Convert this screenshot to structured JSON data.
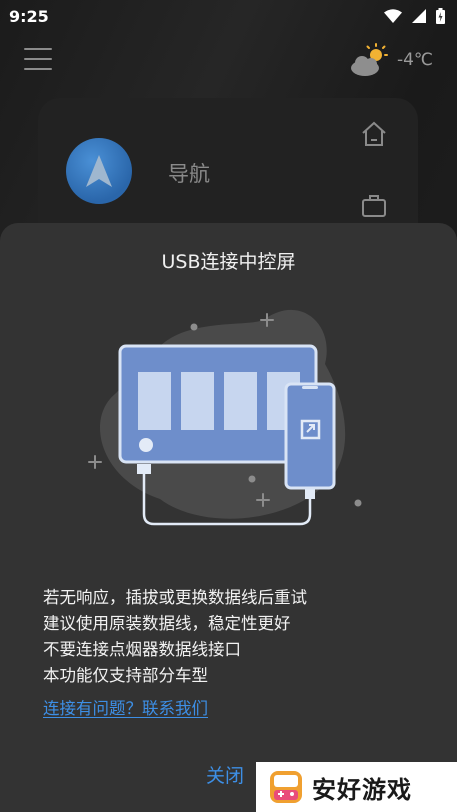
{
  "status_bar": {
    "time": "9:25",
    "icons": [
      "wifi-icon",
      "signal-icon",
      "battery-icon"
    ]
  },
  "header": {
    "menu_icon": "hamburger-menu-icon",
    "weather_icon": "partly-cloudy-icon",
    "temperature": "-4℃"
  },
  "home_card": {
    "nav_label": "导航",
    "side_icons": [
      "home-icon",
      "briefcase-icon"
    ]
  },
  "dialog": {
    "title": "USB连接中控屏",
    "tips": [
      "若无响应，插拔或更换数据线后重试",
      "建议使用原装数据线，稳定性更好",
      "不要连接点烟器数据线接口",
      "本功能仅支持部分车型"
    ],
    "help_link": "连接有问题？联系我们",
    "close_label": "关闭"
  },
  "watermark": {
    "text": "安好游戏"
  }
}
